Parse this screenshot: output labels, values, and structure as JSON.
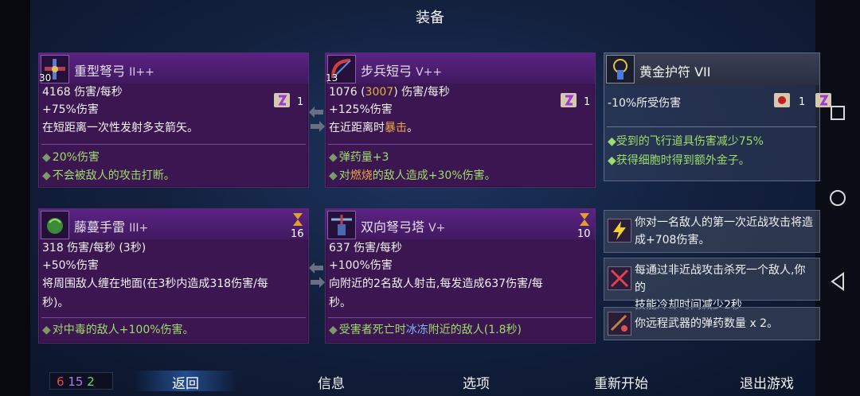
{
  "header": {
    "title": "装备"
  },
  "weapons": [
    {
      "name": "重型弩弓",
      "tier": "II++",
      "level": "30",
      "stat1": "4168 伤害/每秒",
      "stat2": "+75%伤害",
      "desc": "在短距离一次性发射多支箭矢。",
      "scroll_count": "1",
      "bullets": [
        "20%伤害",
        "不会被敌人的攻击打断。"
      ],
      "icon": "heavy-crossbow-icon"
    },
    {
      "name": "步兵短弓",
      "tier": "V++",
      "level": "13",
      "stat1_a": "1076 (",
      "stat1_b": "3007",
      "stat1_c": ") 伤害/每秒",
      "stat2": "+125%伤害",
      "desc_a": "在近距离时",
      "desc_b": "暴击",
      "desc_c": "。",
      "scroll_count": "1",
      "bullet1": "弹药量+3",
      "bullet2_a": "对",
      "bullet2_b": "燃烧",
      "bullet2_c": "的敌人造成+30%伤害。",
      "icon": "infantry-bow-icon"
    }
  ],
  "skills": [
    {
      "name": "藤蔓手雷",
      "tier": "III+",
      "cooldown": "16",
      "stat1": "318 伤害/每秒 (3秒)",
      "stat2": "+50%伤害",
      "desc_line1": "将周围敌人缠在地面(在3秒内造成318伤害/每",
      "desc_line2": "秒)。",
      "bullet_a": "对",
      "bullet_b": "中毒",
      "bullet_c": "的敌人+100%伤害。",
      "icon": "vine-grenade-icon"
    },
    {
      "name": "双向弩弓塔",
      "tier": "V+",
      "cooldown": "10",
      "stat1": "637 伤害/每秒",
      "stat2": "+100%伤害",
      "desc_line1": "向附近的2名敌人射击,每发造成637伤害/每",
      "desc_line2": "秒。",
      "bullet_a": "受害者死亡时",
      "bullet_b": "冰冻",
      "bullet_c": "附近的敌人(1.8秒)",
      "icon": "double-crossbow-turret-icon"
    }
  ],
  "amulet": {
    "name": "黄金护符",
    "tier": "VII",
    "stat": "-10%所受伤害",
    "count": "1",
    "bullets": [
      "受到的飞行道具伤害减少75%",
      "获得细胞时得到额外金子。"
    ]
  },
  "mutations": [
    {
      "line1": "你对一名敌人的第一次近战攻击将造",
      "line2": "成+708伤害。",
      "icon": "lightning-icon"
    },
    {
      "line1": "每通过非近战攻击杀死一个敌人,你的",
      "line2": "技能冷却时间减少2秒",
      "icon": "crossed-arrows-icon"
    },
    {
      "line1": "你远程武器的弹药数量 x 2。",
      "line2": "",
      "icon": "ammo-icon"
    }
  ],
  "stats": {
    "brutality": "6",
    "tactics": "15",
    "survival": "2"
  },
  "menu": [
    "返回",
    "信息",
    "选项",
    "重新开始",
    "退出游戏"
  ],
  "colors": {
    "brutality": "#e24a4a",
    "tactics": "#b27ae8",
    "survival": "#6ad86a",
    "card_bg": "#3b1650",
    "accent": "#3c8cff"
  }
}
